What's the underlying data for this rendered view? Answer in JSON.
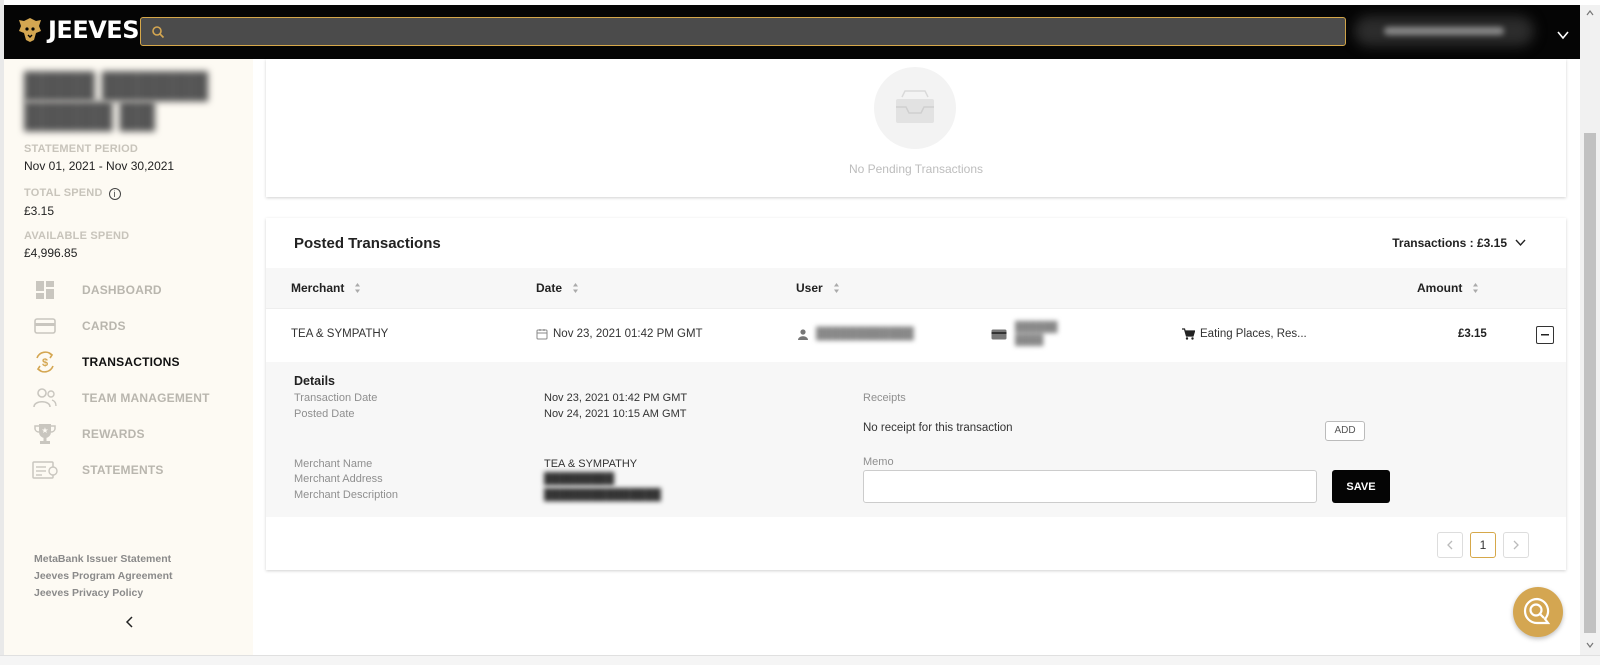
{
  "app": {
    "logo_text": "JEEVES",
    "brand_color": "#d4a651"
  },
  "search": {
    "placeholder": "",
    "value": ""
  },
  "sidebar": {
    "statement_period_label": "STATEMENT PERIOD",
    "statement_period_value": "Nov 01, 2021 - Nov 30,2021",
    "total_spend_label": "TOTAL SPEND",
    "total_spend_value": "£3.15",
    "available_spend_label": "AVAILABLE SPEND",
    "available_spend_value": "£4,996.85",
    "nav": [
      {
        "label": "DASHBOARD",
        "icon": "dashboard-icon",
        "active": false
      },
      {
        "label": "CARDS",
        "icon": "card-icon",
        "active": false
      },
      {
        "label": "TRANSACTIONS",
        "icon": "transactions-icon",
        "active": true
      },
      {
        "label": "TEAM MANAGEMENT",
        "icon": "team-icon",
        "active": false
      },
      {
        "label": "REWARDS",
        "icon": "trophy-icon",
        "active": false
      },
      {
        "label": "STATEMENTS",
        "icon": "statements-icon",
        "active": false
      }
    ],
    "footer_links": [
      "MetaBank Issuer Statement",
      "Jeeves Program Agreement",
      "Jeeves Privacy Policy"
    ]
  },
  "pending": {
    "empty_text": "No Pending Transactions"
  },
  "posted": {
    "title": "Posted Transactions",
    "summary": "Transactions : £3.15",
    "columns": {
      "merchant": "Merchant",
      "date": "Date",
      "user": "User",
      "amount": "Amount"
    },
    "row": {
      "merchant": "TEA & SYMPATHY",
      "date": "Nov 23, 2021 01:42 PM GMT",
      "category": "Eating Places, Res...",
      "amount": "£3.15"
    },
    "details": {
      "title": "Details",
      "transaction_date_label": "Transaction Date",
      "transaction_date_value": "Nov 23, 2021 01:42 PM GMT",
      "posted_date_label": "Posted Date",
      "posted_date_value": "Nov 24, 2021 10:15 AM GMT",
      "merchant_name_label": "Merchant Name",
      "merchant_name_value": "TEA & SYMPATHY",
      "merchant_address_label": "Merchant Address",
      "merchant_description_label": "Merchant Description",
      "receipts_label": "Receipts",
      "no_receipt_text": "No receipt for this transaction",
      "add_label": "ADD",
      "memo_label": "Memo",
      "memo_value": "",
      "save_label": "SAVE"
    },
    "pagination": {
      "current_page": "1"
    }
  }
}
